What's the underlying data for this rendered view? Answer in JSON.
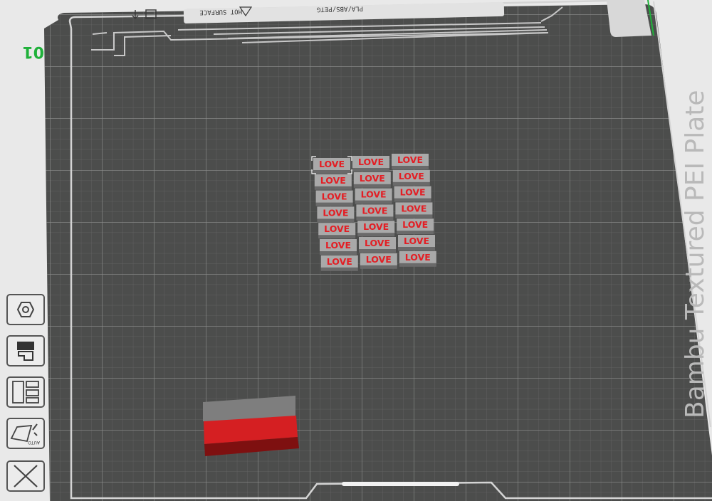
{
  "plate": {
    "name": "Bambu Textured PEI Plate",
    "number": "01",
    "header_labels": [
      "PLA/ABS/PETG",
      "HOT SURFACE"
    ]
  },
  "model": {
    "label": "LOVE",
    "rows": 7,
    "cols": 3
  },
  "toolbar": [
    {
      "name": "orient-button",
      "icon": "hexagon-icon"
    },
    {
      "name": "filament-button",
      "icon": "filament-slot-icon"
    },
    {
      "name": "arrange-button",
      "icon": "arrange-layout-icon"
    },
    {
      "name": "auto-paint-button",
      "icon": "auto-brush-icon",
      "label": "AUTO"
    },
    {
      "name": "clear-button",
      "icon": "cross-icon"
    }
  ],
  "colors": {
    "plate": "#4c4d4c",
    "grid": "#7b7c7b",
    "frame": "#d4d4d4",
    "filament_gray": "#8a8a8a",
    "filament_red": "#d51f22",
    "axis_green": "#1fb13a"
  }
}
